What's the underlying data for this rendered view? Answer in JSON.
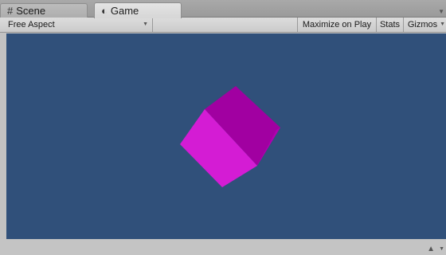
{
  "tabs": [
    {
      "label": "Scene",
      "icon": "grid-icon"
    },
    {
      "label": "Game",
      "icon": "pacman-icon"
    }
  ],
  "toolbar": {
    "aspect_dropdown": "Free Aspect",
    "maximize_label": "Maximize on Play",
    "stats_label": "Stats",
    "gizmos_label": "Gizmos"
  },
  "viewport": {
    "background_color": "#30507a",
    "object": "cube",
    "cube_colors": {
      "top": "#a100a1",
      "left": "#d41cd4",
      "right": "#b000b0"
    }
  },
  "statusbar": {
    "lock_icon": "lock-icon"
  }
}
